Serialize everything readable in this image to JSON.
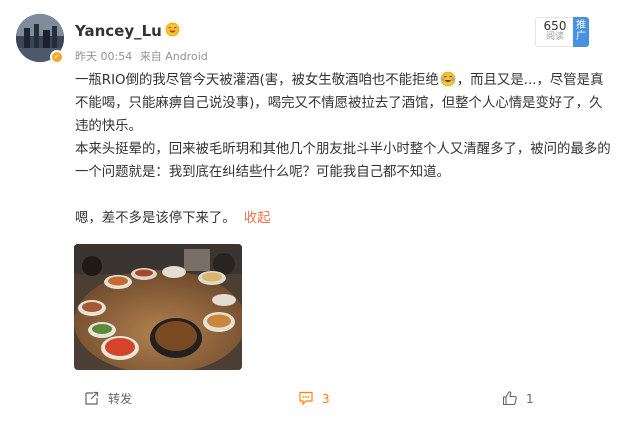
{
  "post": {
    "author": "Yancey_Lu",
    "timestamp": "昨天 00:54",
    "source": "来自 Android",
    "views_count": "650",
    "views_label": "阅读",
    "promote_label": "推广",
    "paragraph1_part1": "一瓶RIO倒的我尽管今天被灌酒(害，被女生敬酒咱也不能拒绝",
    "paragraph1_part2": "，而且又是...，尽管是真不能喝，只能麻痹自己说没事)，喝完又不情愿被拉去了酒馆，但整个人心情是变好了，久违的快乐。",
    "paragraph2": "本来头挺晕的，回来被毛昕玥和其他几个朋友批斗半小时整个人又清醒多了，被问的最多的一个问题就是：我到底在纠结些什么呢？可能我自己都不知道。",
    "paragraph3": "嗯，差不多是该停下来了。",
    "collapse_label": "收起"
  },
  "actions": {
    "repost_label": "转发",
    "comment_count": "3",
    "like_count": "1"
  },
  "icons": {
    "verified": "verified-badge-icon",
    "user_flair": "laughing-face-icon",
    "inline_emoji": "tearful-laugh-emoji-icon",
    "repost": "repost-icon",
    "comment": "comment-icon",
    "like": "thumbs-up-icon"
  },
  "colors": {
    "accent_orange": "#ff8200",
    "link": "#eb7350",
    "promote_blue": "#4a90e2"
  }
}
